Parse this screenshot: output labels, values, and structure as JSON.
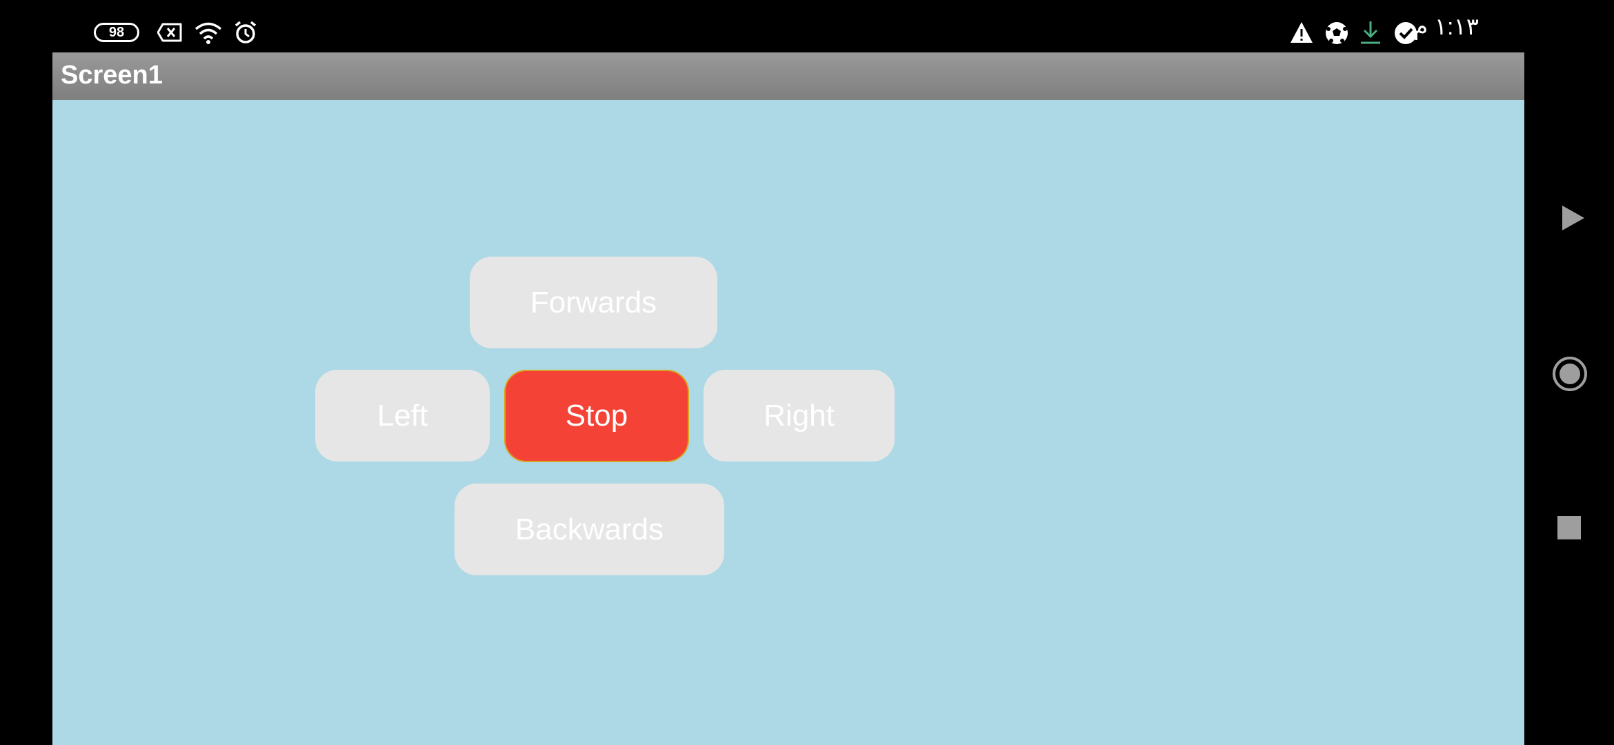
{
  "status_bar": {
    "battery_level": "98",
    "clock": "١:١٣ م",
    "icons_left": [
      "battery-icon",
      "sim-error-icon",
      "wifi-icon",
      "alarm-icon"
    ],
    "icons_right": [
      "warning-icon",
      "soccer-ball-icon",
      "download-icon",
      "check-circle-icon"
    ]
  },
  "app": {
    "title": "Screen1",
    "background_color": "#ADD8E6"
  },
  "controls": {
    "forwards_label": "Forwards",
    "left_label": "Left",
    "stop_label": "Stop",
    "right_label": "Right",
    "backwards_label": "Backwards",
    "button_color": "#E6E6E6",
    "stop_color": "#F44336"
  },
  "navigation_bar": {
    "buttons": [
      "back-triangle-icon",
      "home-circle-icon",
      "recents-square-icon"
    ]
  }
}
